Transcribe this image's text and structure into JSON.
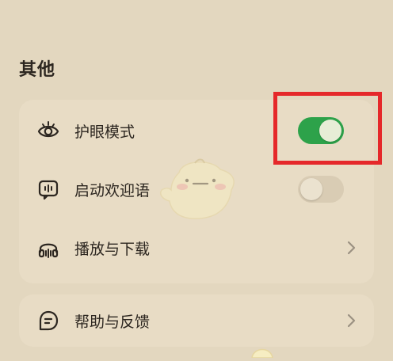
{
  "section": {
    "title": "其他"
  },
  "settings": {
    "items": [
      {
        "label": "护眼模式",
        "icon": "eye-icon",
        "control": "toggle",
        "checked": true
      },
      {
        "label": "启动欢迎语",
        "icon": "chat-mic-icon",
        "control": "toggle",
        "checked": false
      },
      {
        "label": "播放与下载",
        "icon": "headphones-icon",
        "control": "chevron"
      }
    ],
    "help": {
      "label": "帮助与反馈",
      "icon": "feedback-icon",
      "control": "chevron"
    }
  },
  "colors": {
    "background": "#e3d7bf",
    "card": "#e8dcc5",
    "toggle_on": "#2da24a",
    "toggle_off": "#d9ccb4",
    "highlight": "#e5282a",
    "text": "#2c2620"
  }
}
